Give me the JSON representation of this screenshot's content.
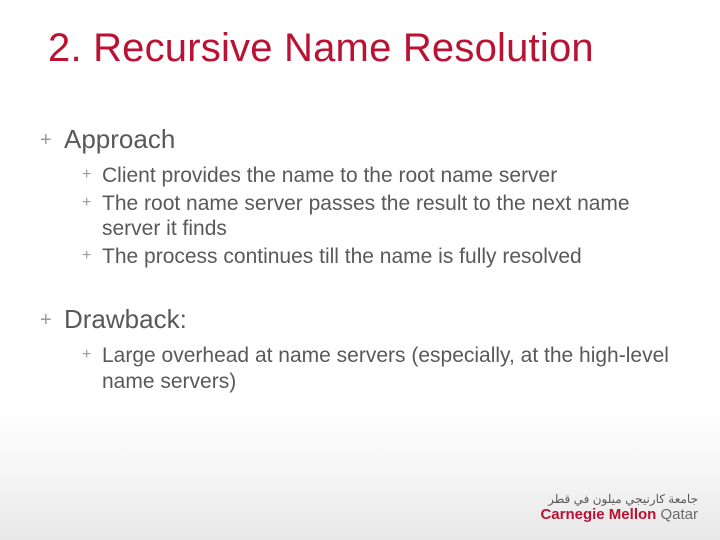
{
  "title": "2. Recursive Name Resolution",
  "sections": [
    {
      "heading": "Approach",
      "items": [
        "Client provides the name to the root name server",
        "The root name server passes the result to the next name server it finds",
        "The process continues till the name is fully resolved"
      ]
    },
    {
      "heading": "Drawback:",
      "items": [
        "Large overhead at name servers (especially, at the high-level name servers)"
      ]
    }
  ],
  "logo": {
    "arabic": "جامعة كارنيجي ميلون في قطر",
    "cm": "Carnegie Mellon",
    "qatar": " Qatar"
  },
  "bullet": "+"
}
